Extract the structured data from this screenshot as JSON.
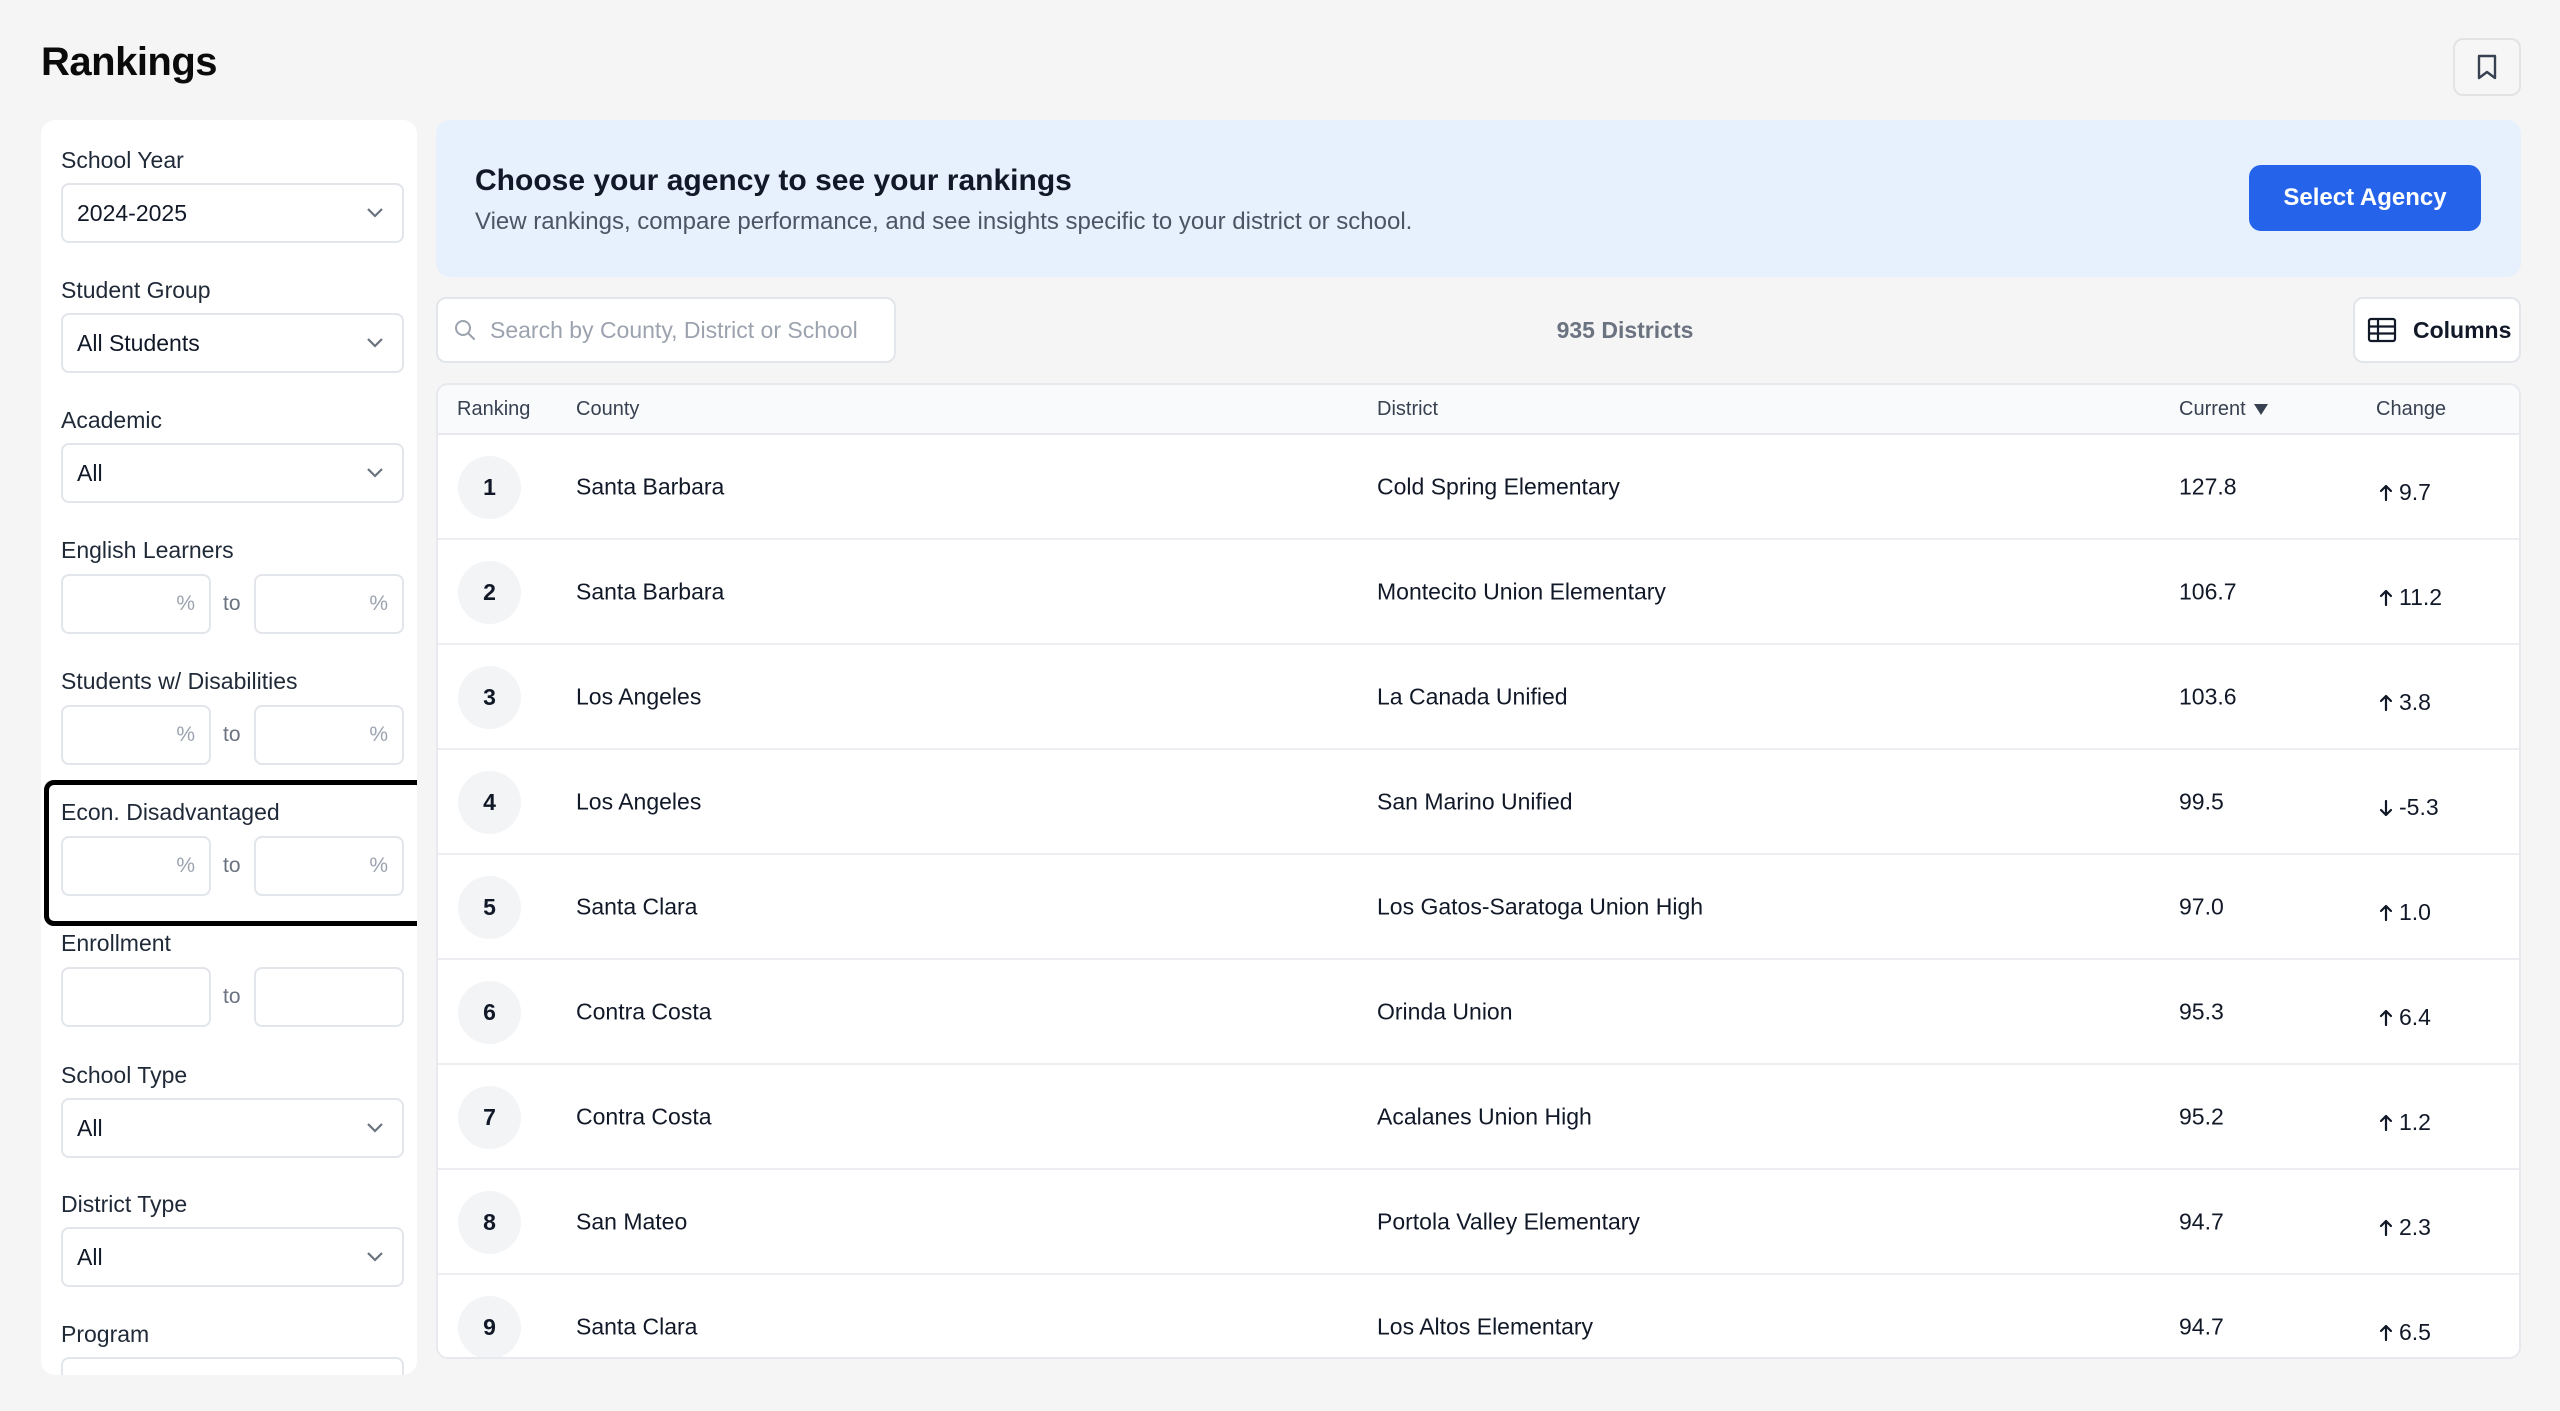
{
  "page": {
    "title": "Rankings"
  },
  "filters": {
    "school_year": {
      "label": "School Year",
      "value": "2024-2025"
    },
    "student_group": {
      "label": "Student Group",
      "value": "All Students"
    },
    "academic": {
      "label": "Academic",
      "value": "All"
    },
    "english_learners": {
      "label": "English Learners",
      "unit": "%",
      "to": "to"
    },
    "students_disabilities": {
      "label": "Students w/ Disabilities",
      "unit": "%",
      "to": "to"
    },
    "econ_disadvantaged": {
      "label": "Econ. Disadvantaged",
      "unit": "%",
      "to": "to"
    },
    "enrollment": {
      "label": "Enrollment",
      "to": "to"
    },
    "school_type": {
      "label": "School Type",
      "value": "All"
    },
    "district_type": {
      "label": "District Type",
      "value": "All"
    },
    "program": {
      "label": "Program"
    }
  },
  "banner": {
    "title": "Choose your agency to see your rankings",
    "subtitle": "View rankings, compare performance, and see insights specific to your district or school.",
    "button": "Select Agency"
  },
  "toolbar": {
    "search_placeholder": "Search by County, District or School",
    "count": "935 Districts",
    "columns_button": "Columns"
  },
  "table": {
    "headers": {
      "ranking": "Ranking",
      "county": "County",
      "district": "District",
      "current": "Current",
      "change": "Change"
    },
    "rows": [
      {
        "rank": "1",
        "county": "Santa Barbara",
        "district": "Cold Spring Elementary",
        "current": "127.8",
        "change": "9.7",
        "direction": "up"
      },
      {
        "rank": "2",
        "county": "Santa Barbara",
        "district": "Montecito Union Elementary",
        "current": "106.7",
        "change": "11.2",
        "direction": "up"
      },
      {
        "rank": "3",
        "county": "Los Angeles",
        "district": "La Canada Unified",
        "current": "103.6",
        "change": "3.8",
        "direction": "up"
      },
      {
        "rank": "4",
        "county": "Los Angeles",
        "district": "San Marino Unified",
        "current": "99.5",
        "change": "-5.3",
        "direction": "down"
      },
      {
        "rank": "5",
        "county": "Santa Clara",
        "district": "Los Gatos-Saratoga Union High",
        "current": "97.0",
        "change": "1.0",
        "direction": "up"
      },
      {
        "rank": "6",
        "county": "Contra Costa",
        "district": "Orinda Union",
        "current": "95.3",
        "change": "6.4",
        "direction": "up"
      },
      {
        "rank": "7",
        "county": "Contra Costa",
        "district": "Acalanes Union High",
        "current": "95.2",
        "change": "1.2",
        "direction": "up"
      },
      {
        "rank": "8",
        "county": "San Mateo",
        "district": "Portola Valley Elementary",
        "current": "94.7",
        "change": "2.3",
        "direction": "up"
      },
      {
        "rank": "9",
        "county": "Santa Clara",
        "district": "Los Altos Elementary",
        "current": "94.7",
        "change": "6.5",
        "direction": "up"
      }
    ]
  }
}
